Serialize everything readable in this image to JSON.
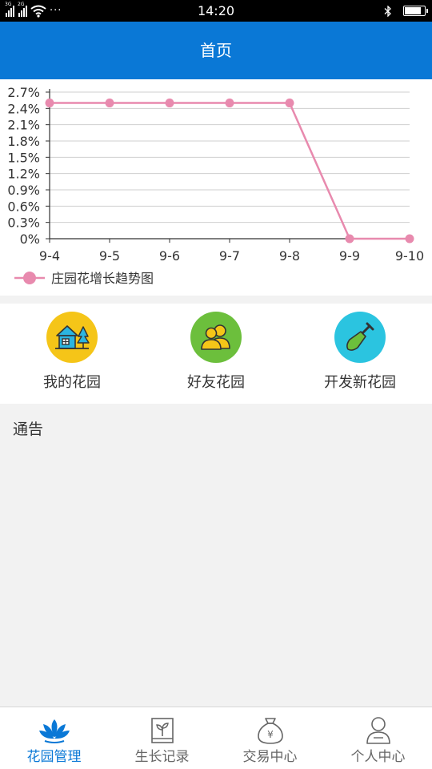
{
  "status_bar": {
    "network1": "3G",
    "network2": "2G",
    "dots": "···",
    "time": "14:20",
    "battery_level": 0.85
  },
  "header": {
    "title": "首页"
  },
  "chart_data": {
    "type": "line",
    "categories": [
      "9-4",
      "9-5",
      "9-6",
      "9-7",
      "9-8",
      "9-9",
      "9-10"
    ],
    "series": [
      {
        "name": "庄园花增长趋势图",
        "values": [
          2.5,
          2.5,
          2.5,
          2.5,
          2.5,
          0,
          0
        ],
        "color": "#e88aae"
      }
    ],
    "yticks": [
      "0%",
      "0.3%",
      "0.6%",
      "0.9%",
      "1.2%",
      "1.5%",
      "1.8%",
      "2.1%",
      "2.4%",
      "2.7%"
    ],
    "ylim": [
      0,
      2.7
    ],
    "grid": true,
    "legend": "bottom-left",
    "title": "",
    "xlabel": "",
    "ylabel": ""
  },
  "shortcuts": [
    {
      "label": "我的花园",
      "icon": "house-tree-icon",
      "color": "#f5c518"
    },
    {
      "label": "好友花园",
      "icon": "friends-icon",
      "color": "#6cbf3c"
    },
    {
      "label": "开发新花园",
      "icon": "shovel-icon",
      "color": "#2bc4e0"
    }
  ],
  "notice": {
    "title": "通告"
  },
  "tabs": [
    {
      "label": "花园管理",
      "icon": "lotus-icon",
      "active": true
    },
    {
      "label": "生长记录",
      "icon": "notebook-sprout-icon",
      "active": false
    },
    {
      "label": "交易中心",
      "icon": "money-bag-icon",
      "active": false
    },
    {
      "label": "个人中心",
      "icon": "person-icon",
      "active": false
    }
  ],
  "colors": {
    "primary": "#0a78d6",
    "line": "#e88aae"
  }
}
